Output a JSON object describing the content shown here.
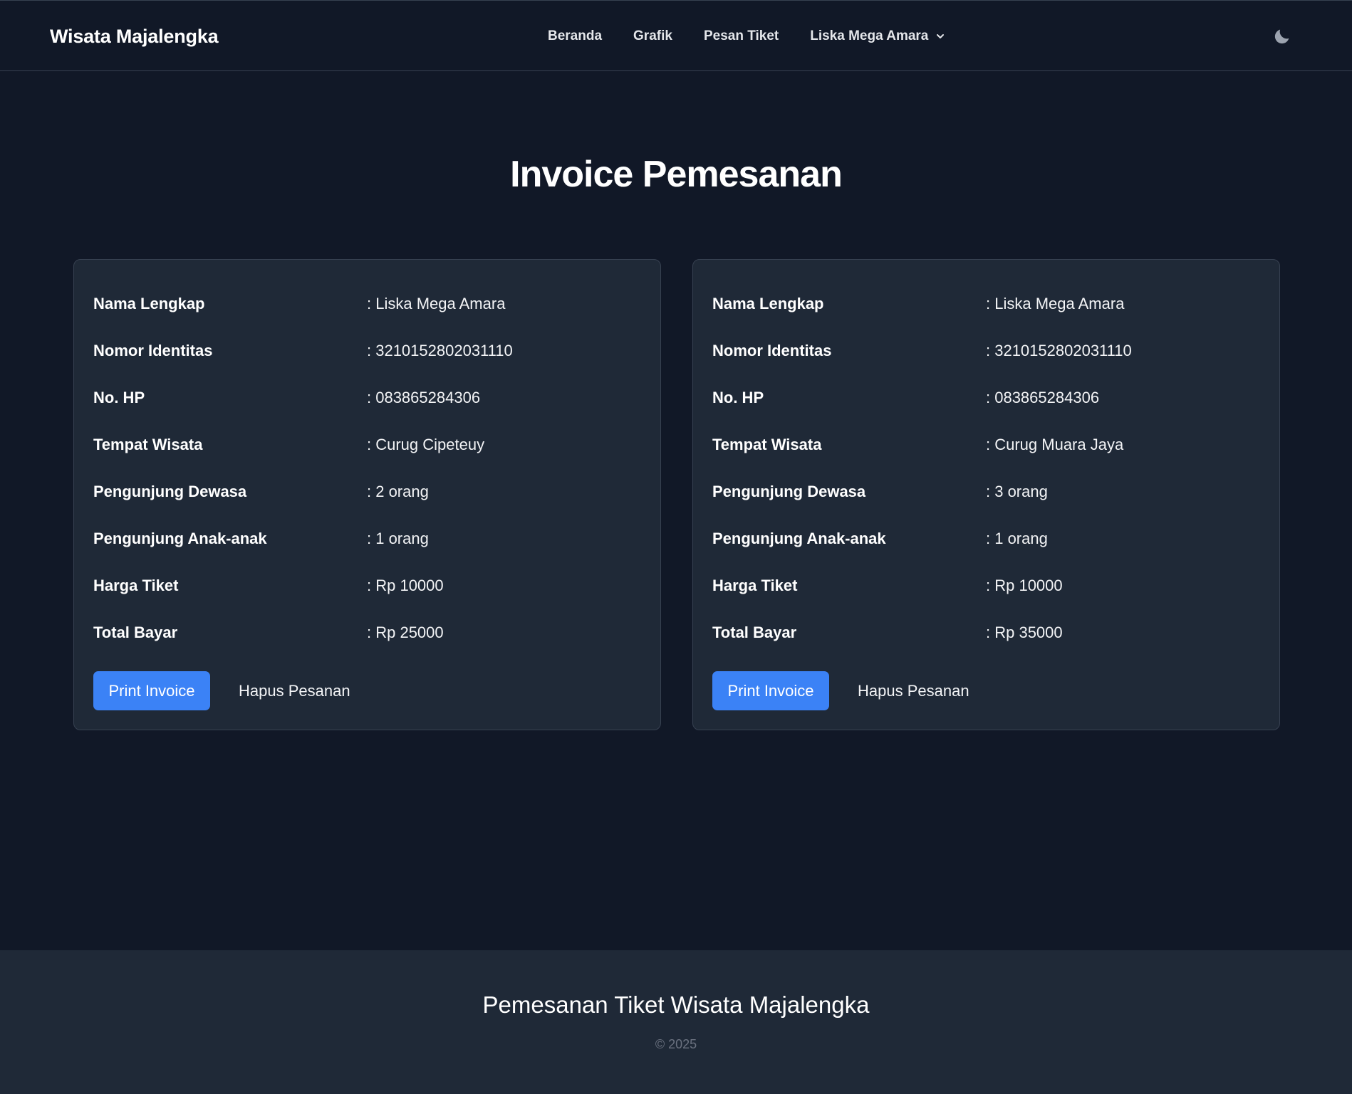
{
  "navbar": {
    "brand": "Wisata Majalengka",
    "links": [
      "Beranda",
      "Grafik",
      "Pesan Tiket"
    ],
    "user_menu": "Liska Mega Amara",
    "theme_icon": "moon-icon"
  },
  "page_title": "Invoice Pemesanan",
  "labels": {
    "nama": "Nama Lengkap",
    "identitas": "Nomor Identitas",
    "hp": "No. HP",
    "tempat": "Tempat Wisata",
    "dewasa": "Pengunjung Dewasa",
    "anak": "Pengunjung Anak-anak",
    "harga": "Harga Tiket",
    "total": "Total Bayar"
  },
  "invoices": [
    {
      "nama": ": Liska Mega Amara",
      "identitas": ": 3210152802031110",
      "hp": ": 083865284306",
      "tempat": ": Curug Cipeteuy",
      "dewasa": ": 2 orang",
      "anak": ": 1 orang",
      "harga": ": Rp 10000",
      "total": ": Rp 25000",
      "print_label": "Print Invoice",
      "delete_label": "Hapus Pesanan"
    },
    {
      "nama": ": Liska Mega Amara",
      "identitas": ": 3210152802031110",
      "hp": ": 083865284306",
      "tempat": ": Curug Muara Jaya",
      "dewasa": ": 3 orang",
      "anak": ": 1 orang",
      "harga": ": Rp 10000",
      "total": ": Rp 35000",
      "print_label": "Print Invoice",
      "delete_label": "Hapus Pesanan"
    }
  ],
  "footer": {
    "title": "Pemesanan Tiket Wisata Majalengka",
    "copyright": "© 2025"
  },
  "colors": {
    "background": "#111827",
    "card": "#1f2937",
    "accent": "#3b82f6",
    "muted": "#6b7280"
  }
}
